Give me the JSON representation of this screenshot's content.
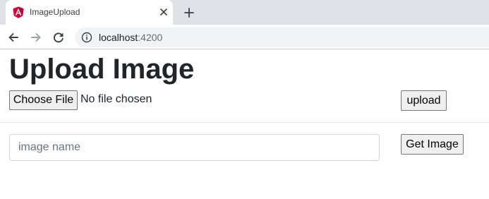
{
  "browser": {
    "tab": {
      "title": "ImageUpload",
      "favicon": "angular-icon",
      "favicon_color": "#dd0031"
    },
    "address": {
      "host": "localhost",
      "port": ":4200"
    },
    "icons": {
      "back": "arrow-left-icon",
      "forward": "arrow-right-icon",
      "reload": "reload-icon",
      "info": "info-icon",
      "close": "close-icon",
      "new_tab": "plus-icon"
    }
  },
  "page": {
    "title": "Upload Image",
    "file_input": {
      "button_label": "Choose File",
      "status": "No file chosen"
    },
    "upload_button": "upload",
    "image_name_input": {
      "placeholder": "image name",
      "value": ""
    },
    "get_image_button": "Get Image"
  }
}
